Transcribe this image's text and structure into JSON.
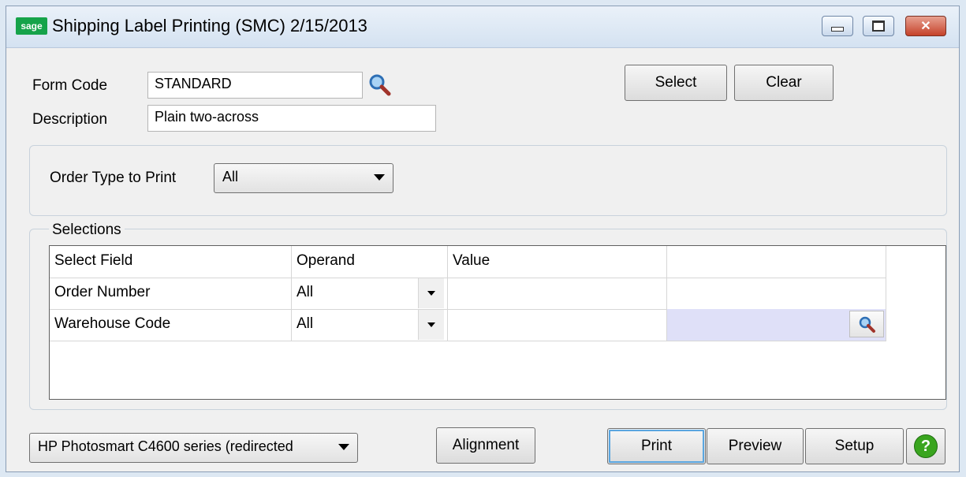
{
  "window": {
    "logo": "sage",
    "title": "Shipping Label Printing (SMC) 2/15/2013",
    "controls": [
      "minimize-icon",
      "maximize-icon",
      "close-icon"
    ],
    "close_glyph": "✕"
  },
  "form": {
    "form_code_label": "Form Code",
    "form_code_value": "STANDARD",
    "description_label": "Description",
    "description_value": "Plain two-across"
  },
  "top_buttons": {
    "select_label": "Select",
    "clear_label": "Clear"
  },
  "order_type": {
    "label": "Order Type to Print",
    "value": "All"
  },
  "selections": {
    "legend": "Selections",
    "headers": [
      "Select Field",
      "Operand",
      "Value",
      ""
    ],
    "rows": [
      {
        "field": "Order Number",
        "operand": "All",
        "value": "",
        "extra": ""
      },
      {
        "field": "Warehouse Code",
        "operand": "All",
        "value": "",
        "extra": ""
      }
    ]
  },
  "footer": {
    "printer": "HP Photosmart C4600 series (redirected",
    "alignment_label": "Alignment",
    "print_label": "Print",
    "preview_label": "Preview",
    "setup_label": "Setup",
    "help_glyph": "?"
  },
  "colors": {
    "accent": "#16a34a",
    "lookup_cell": "#dfe0f8",
    "close_button": "#c5422a"
  }
}
